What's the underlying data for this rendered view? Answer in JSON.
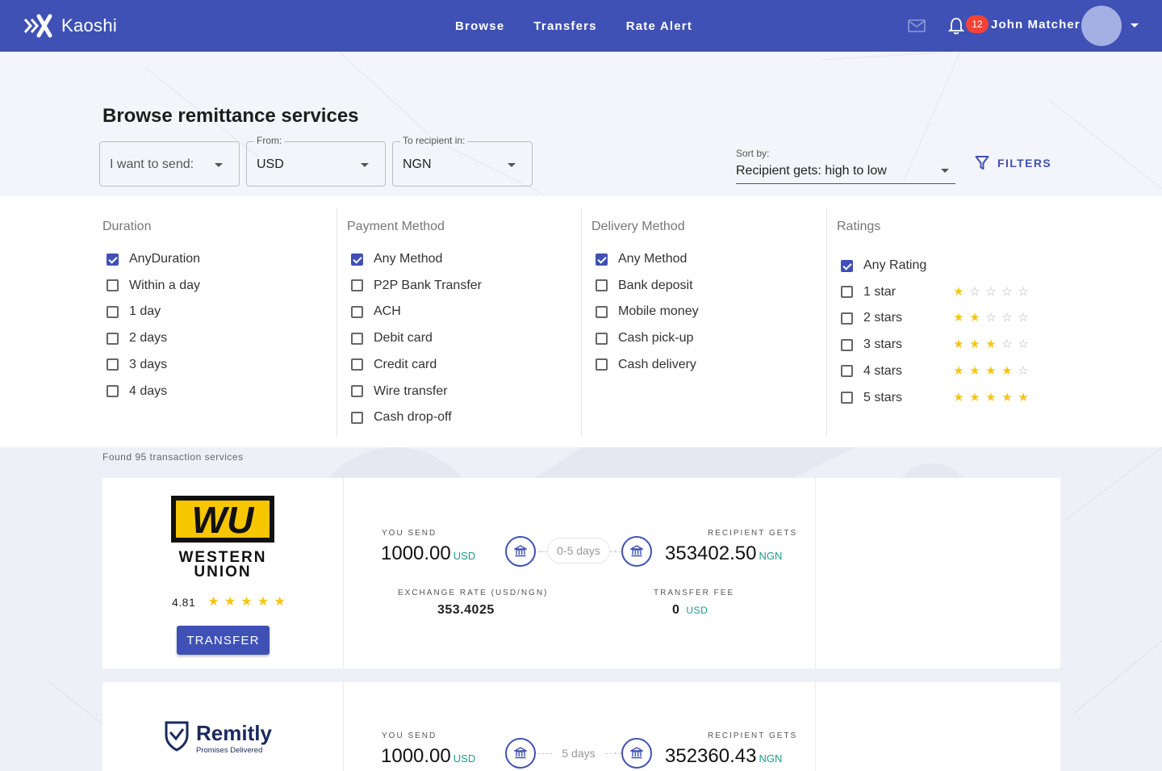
{
  "app": {
    "name": "Kaoshi"
  },
  "nav": [
    "Browse",
    "Transfers",
    "Rate Alert"
  ],
  "header": {
    "notification_count": "12",
    "user_name": "John Matcher"
  },
  "page": {
    "title": "Browse remittance services"
  },
  "search": {
    "send_placeholder": "I want to send:",
    "from_label": "From:",
    "from_value": "USD",
    "to_label": "To recipient in:",
    "to_value": "NGN",
    "sort_label": "Sort by:",
    "sort_value": "Recipient gets: high to low",
    "filters_label": "FILTERS"
  },
  "filters": {
    "duration": {
      "title": "Duration",
      "options": [
        {
          "label": "AnyDuration",
          "checked": true
        },
        {
          "label": "Within a day",
          "checked": false
        },
        {
          "label": "1 day",
          "checked": false
        },
        {
          "label": "2 days",
          "checked": false
        },
        {
          "label": "3 days",
          "checked": false
        },
        {
          "label": "4 days",
          "checked": false
        }
      ]
    },
    "payment": {
      "title": "Payment Method",
      "options": [
        {
          "label": "Any Method",
          "checked": true
        },
        {
          "label": "P2P Bank Transfer",
          "checked": false
        },
        {
          "label": "ACH",
          "checked": false
        },
        {
          "label": "Debit card",
          "checked": false
        },
        {
          "label": "Credit card",
          "checked": false
        },
        {
          "label": "Wire transfer",
          "checked": false
        },
        {
          "label": "Cash drop-off",
          "checked": false
        }
      ]
    },
    "delivery": {
      "title": "Delivery Method",
      "options": [
        {
          "label": "Any Method",
          "checked": true
        },
        {
          "label": "Bank deposit",
          "checked": false
        },
        {
          "label": "Mobile money",
          "checked": false
        },
        {
          "label": "Cash pick-up",
          "checked": false
        },
        {
          "label": "Cash delivery",
          "checked": false
        }
      ]
    },
    "ratings": {
      "title": "Ratings",
      "options": [
        {
          "label": "Any Rating",
          "checked": true,
          "stars": 0
        },
        {
          "label": "1 star",
          "checked": false,
          "stars": 1
        },
        {
          "label": "2 stars",
          "checked": false,
          "stars": 2
        },
        {
          "label": "3 stars",
          "checked": false,
          "stars": 3
        },
        {
          "label": "4 stars",
          "checked": false,
          "stars": 4
        },
        {
          "label": "5 stars",
          "checked": false,
          "stars": 5
        }
      ]
    }
  },
  "results": {
    "found_text": "Found 95 transaction services",
    "labels": {
      "you_send": "YOU SEND",
      "recipient_gets": "RECIPIENT GETS",
      "exchange_rate": "EXCHANGE RATE (USD/NGN)",
      "transfer_fee": "TRANSFER FEE",
      "transfer_button": "TRANSFER"
    },
    "services": [
      {
        "provider_lines": [
          "WESTERN",
          "UNION"
        ],
        "provider_mark": "WU",
        "rating": "4.81",
        "rating_stars": 5,
        "send_amount": "1000.00",
        "send_currency": "USD",
        "duration": "0-5 days",
        "receive_amount": "353402.50",
        "receive_currency": "NGN",
        "exchange_rate": "353.4025",
        "fee": "0",
        "fee_currency": "USD"
      },
      {
        "provider": "Remitly",
        "tagline": "Promises Delivered",
        "send_amount": "1000.00",
        "send_currency": "USD",
        "duration": "5 days",
        "receive_amount": "352360.43",
        "receive_currency": "NGN"
      }
    ]
  },
  "colors": {
    "primary": "#3f51b5",
    "accent_text": "#1f9b8a",
    "star": "#f5c518",
    "badge": "#f44336"
  }
}
